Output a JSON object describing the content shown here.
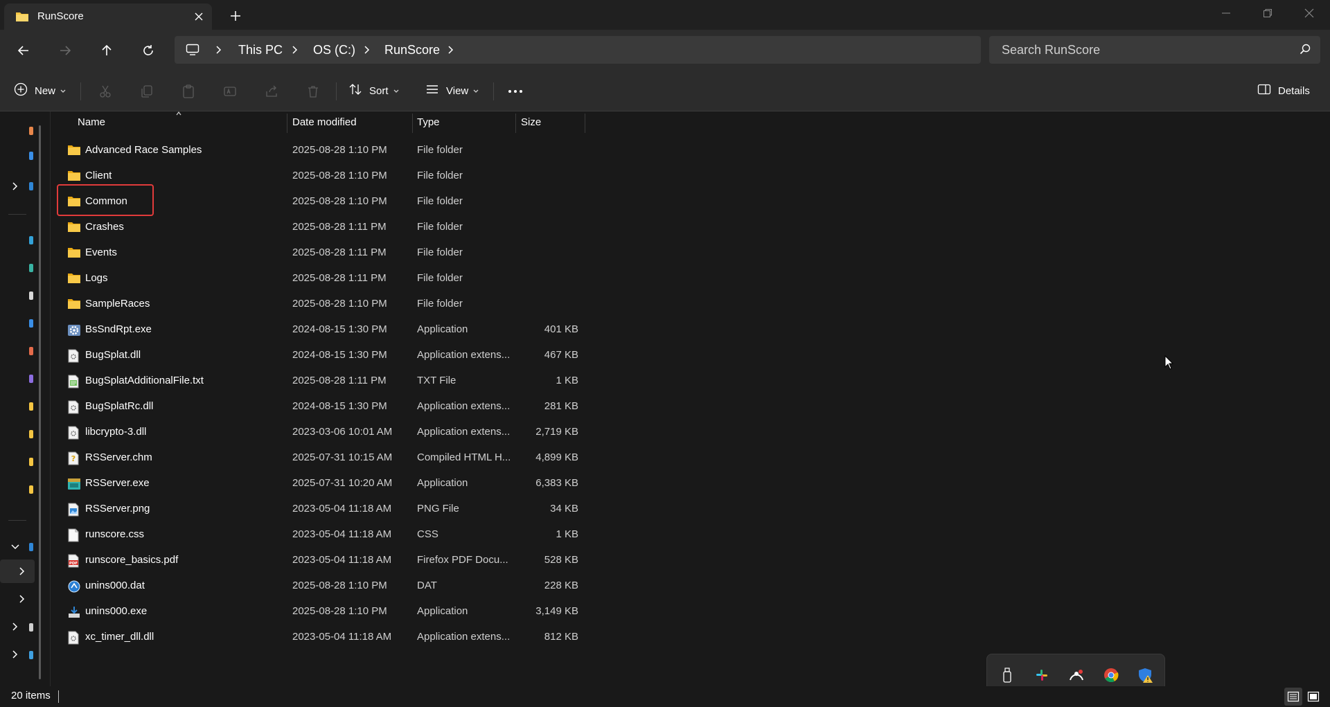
{
  "tab": {
    "title": "RunScore"
  },
  "breadcrumb": [
    "This PC",
    "OS (C:)",
    "RunScore"
  ],
  "search": {
    "placeholder": "Search RunScore"
  },
  "toolbar": {
    "new_label": "New",
    "sort_label": "Sort",
    "view_label": "View",
    "details_label": "Details"
  },
  "columns": {
    "name": "Name",
    "date": "Date modified",
    "type": "Type",
    "size": "Size"
  },
  "files": [
    {
      "name": "Advanced Race Samples",
      "date": "2025-08-28 1:10 PM",
      "type": "File folder",
      "size": "",
      "icon": "folder-icon"
    },
    {
      "name": "Client",
      "date": "2025-08-28 1:10 PM",
      "type": "File folder",
      "size": "",
      "icon": "folder-icon"
    },
    {
      "name": "Common",
      "date": "2025-08-28 1:10 PM",
      "type": "File folder",
      "size": "",
      "icon": "folder-icon"
    },
    {
      "name": "Crashes",
      "date": "2025-08-28 1:11 PM",
      "type": "File folder",
      "size": "",
      "icon": "folder-icon"
    },
    {
      "name": "Events",
      "date": "2025-08-28 1:11 PM",
      "type": "File folder",
      "size": "",
      "icon": "folder-icon"
    },
    {
      "name": "Logs",
      "date": "2025-08-28 1:11 PM",
      "type": "File folder",
      "size": "",
      "icon": "folder-icon"
    },
    {
      "name": "SampleRaces",
      "date": "2025-08-28 1:10 PM",
      "type": "File folder",
      "size": "",
      "icon": "folder-icon"
    },
    {
      "name": "BsSndRpt.exe",
      "date": "2024-08-15 1:30 PM",
      "type": "Application",
      "size": "401 KB",
      "icon": "gear-exe-icon"
    },
    {
      "name": "BugSplat.dll",
      "date": "2024-08-15 1:30 PM",
      "type": "Application extens...",
      "size": "467 KB",
      "icon": "dll-icon"
    },
    {
      "name": "BugSplatAdditionalFile.txt",
      "date": "2025-08-28 1:11 PM",
      "type": "TXT File",
      "size": "1 KB",
      "icon": "txt-icon"
    },
    {
      "name": "BugSplatRc.dll",
      "date": "2024-08-15 1:30 PM",
      "type": "Application extens...",
      "size": "281 KB",
      "icon": "dll-icon"
    },
    {
      "name": "libcrypto-3.dll",
      "date": "2023-03-06 10:01 AM",
      "type": "Application extens...",
      "size": "2,719 KB",
      "icon": "dll-icon"
    },
    {
      "name": "RSServer.chm",
      "date": "2025-07-31 10:15 AM",
      "type": "Compiled HTML H...",
      "size": "4,899 KB",
      "icon": "chm-icon"
    },
    {
      "name": "RSServer.exe",
      "date": "2025-07-31 10:20 AM",
      "type": "Application",
      "size": "6,383 KB",
      "icon": "app-exe-icon"
    },
    {
      "name": "RSServer.png",
      "date": "2023-05-04 11:18 AM",
      "type": "PNG File",
      "size": "34 KB",
      "icon": "image-icon"
    },
    {
      "name": "runscore.css",
      "date": "2023-05-04 11:18 AM",
      "type": "CSS",
      "size": "1 KB",
      "icon": "document-icon"
    },
    {
      "name": "runscore_basics.pdf",
      "date": "2023-05-04 11:18 AM",
      "type": "Firefox PDF Docu...",
      "size": "528 KB",
      "icon": "pdf-icon"
    },
    {
      "name": "unins000.dat",
      "date": "2025-08-28 1:10 PM",
      "type": "DAT",
      "size": "228 KB",
      "icon": "dat-icon"
    },
    {
      "name": "unins000.exe",
      "date": "2025-08-28 1:10 PM",
      "type": "Application",
      "size": "3,149 KB",
      "icon": "installer-icon"
    },
    {
      "name": "xc_timer_dll.dll",
      "date": "2023-05-04 11:18 AM",
      "type": "Application extens...",
      "size": "812 KB",
      "icon": "dll-icon"
    }
  ],
  "status": {
    "item_count": "20 items"
  },
  "colors": {
    "background": "#191919",
    "chrome": "#2c2c2c",
    "folder": "#f4c542",
    "highlight": "#e23b3b",
    "accent": "#4cc2ff"
  }
}
